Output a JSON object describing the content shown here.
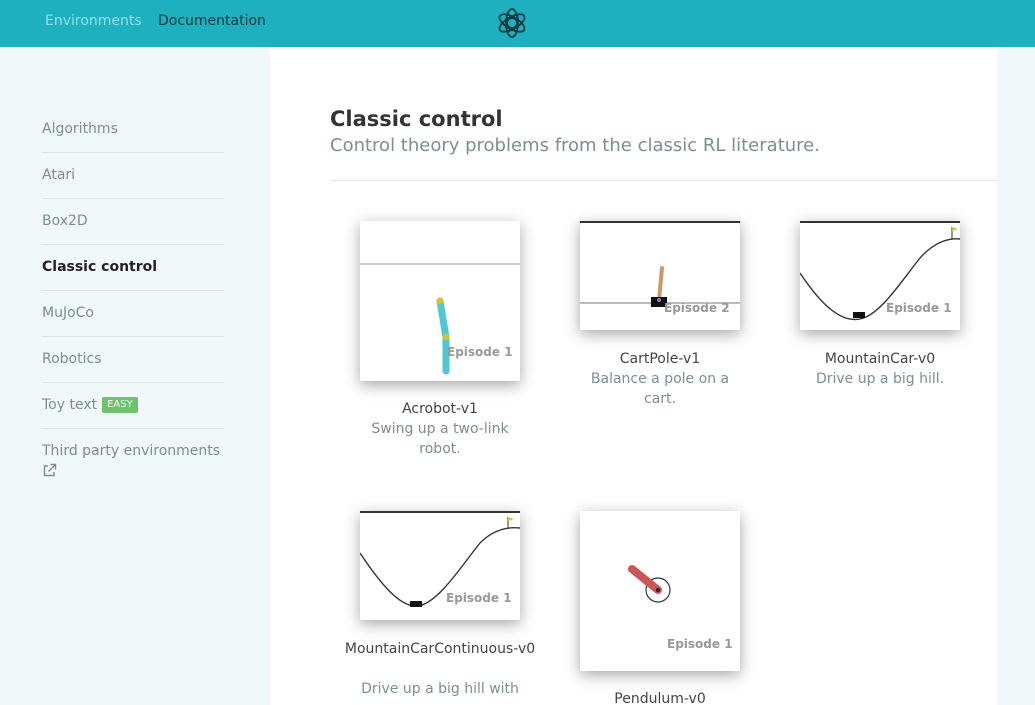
{
  "header": {
    "nav": [
      "Environments",
      "Documentation"
    ],
    "logo_icon": "openai-logo-icon"
  },
  "sidebar": {
    "items": [
      {
        "label": "Algorithms"
      },
      {
        "label": "Atari"
      },
      {
        "label": "Box2D"
      },
      {
        "label": "Classic control",
        "active": true
      },
      {
        "label": "MuJoCo"
      },
      {
        "label": "Robotics"
      },
      {
        "label": "Toy text",
        "badge": "EASY"
      },
      {
        "label": "Third party environments",
        "icon": "external-link-icon"
      }
    ]
  },
  "main": {
    "title": "Classic control",
    "subtitle": "Control theory problems from the classic RL literature.",
    "environments": [
      {
        "name": "Acrobot-v1",
        "desc": "Swing up a two-link robot.",
        "episode": "Episode 1"
      },
      {
        "name": "CartPole-v1",
        "desc": "Balance a pole on a cart.",
        "episode": "Episode 2"
      },
      {
        "name": "MountainCar-v0",
        "desc": "Drive up a big hill.",
        "episode": "Episode 1"
      },
      {
        "name": "MountainCarContinuous-v0",
        "desc": "Drive up a big hill with",
        "episode": "Episode 1"
      },
      {
        "name": "Pendulum-v0",
        "desc": "",
        "episode": "Episode 1"
      }
    ]
  },
  "colors": {
    "header": "#1eb0bf",
    "badge": "#6cc36c",
    "acrobot_link": "#4fc8d3",
    "pendulum": "#cc5555"
  }
}
